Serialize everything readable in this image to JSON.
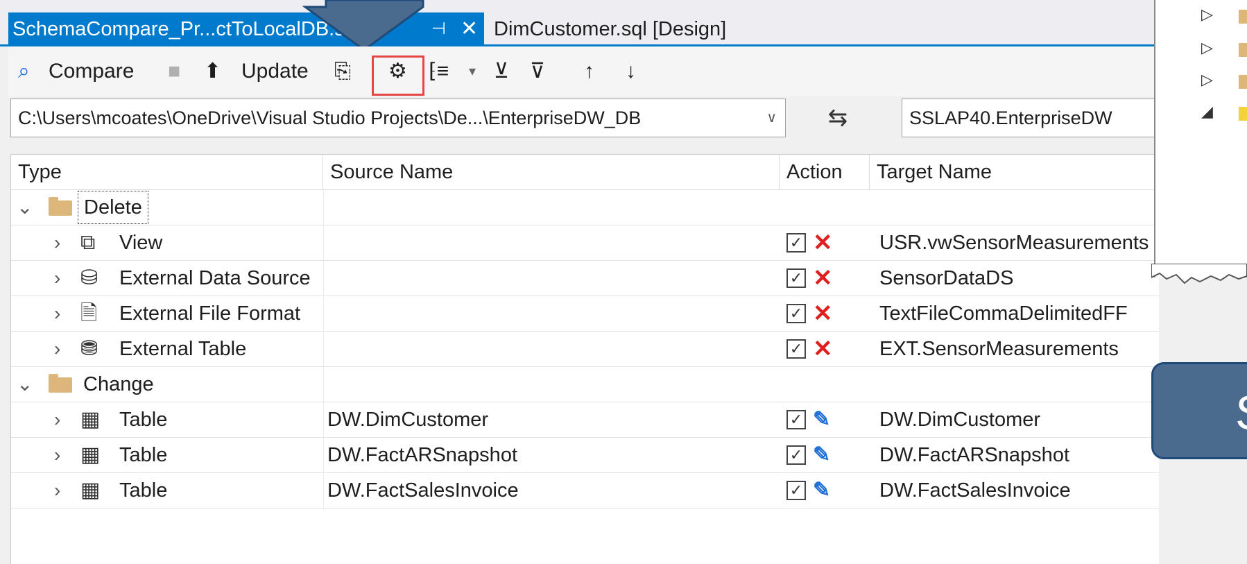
{
  "tabs": {
    "active": {
      "label": "SchemaCompare_Pr...ctToLocalDB.s",
      "pin": "⊣",
      "close": "✕"
    },
    "second": {
      "label": "DimCustomer.sql [Design]"
    }
  },
  "toolbar": {
    "compare_label": "Compare",
    "update_label": "Update"
  },
  "paths": {
    "source": "C:\\Users\\mcoates\\OneDrive\\Visual Studio Projects\\De...\\EnterpriseDW_DB",
    "target": "SSLAP40.EnterpriseDW",
    "swap": "⇆"
  },
  "grid": {
    "columns": [
      "Type",
      "Source Name",
      "Action",
      "Target Name"
    ],
    "groups": [
      {
        "label": "Delete",
        "rows": [
          {
            "type": "View",
            "icon": "view-icon",
            "source": "",
            "action": "delete",
            "target": "USR.vwSensorMeasurements"
          },
          {
            "type": "External Data Source",
            "icon": "external-data-source-icon",
            "source": "",
            "action": "delete",
            "target": "SensorDataDS"
          },
          {
            "type": "External File Format",
            "icon": "external-file-format-icon",
            "source": "",
            "action": "delete",
            "target": "TextFileCommaDelimitedFF"
          },
          {
            "type": "External Table",
            "icon": "external-table-icon",
            "source": "",
            "action": "delete",
            "target": "EXT.SensorMeasurements"
          }
        ]
      },
      {
        "label": "Change",
        "rows": [
          {
            "type": "Table",
            "icon": "table-icon",
            "source": "DW.DimCustomer",
            "action": "change",
            "target": "DW.DimCustomer"
          },
          {
            "type": "Table",
            "icon": "table-icon",
            "source": "DW.FactARSnapshot",
            "action": "change",
            "target": "DW.FactARSnapshot"
          },
          {
            "type": "Table",
            "icon": "table-icon",
            "source": "DW.FactSalesInvoice",
            "action": "change",
            "target": "DW.FactSalesInvoice"
          }
        ]
      }
    ]
  },
  "callout": {
    "text": "S"
  },
  "colors": {
    "accent": "#007acc",
    "delete": "#e02020",
    "change": "#1f6fd6",
    "highlight": "#e64646",
    "callout": "#4a6a8e"
  }
}
